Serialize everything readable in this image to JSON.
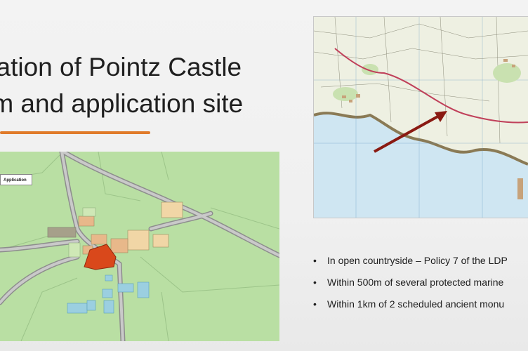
{
  "slide": {
    "title_line1": "cation of Pointz Castle",
    "title_line2": "rm and application site",
    "left_map": {
      "label": "Application"
    },
    "bullets": [
      "In open countryside – Policy 7 of the LDP",
      "Within 500m of several protected marine",
      "Within 1km of 2 scheduled ancient monu"
    ]
  },
  "colors": {
    "accent_underline": "#e07b2a",
    "field_green": "#b9dfa3",
    "site_red": "#d9481b",
    "sea_blue": "#cfe6f2",
    "arrow_red": "#8a1a12"
  },
  "icons": [
    "bullet-dot",
    "location-arrow"
  ]
}
